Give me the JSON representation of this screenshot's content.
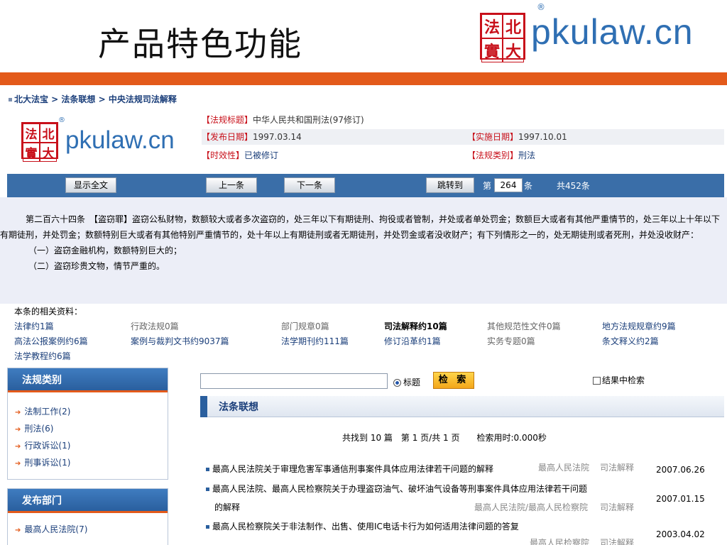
{
  "slide": {
    "title": "产品特色功能"
  },
  "brand": {
    "seal_chars": [
      "法",
      "北",
      "實",
      "大"
    ],
    "name": "pkulaw.cn",
    "registered": "®"
  },
  "breadcrumb": "北大法宝 > 法条联想 > 中央法规司法解释",
  "meta": {
    "title_key": "【法规标题】",
    "title_val": "中华人民共和国刑法(97修订)",
    "pub_key": "【发布日期】",
    "pub_val": "1997.03.14",
    "impl_key": "【实施日期】",
    "impl_val": "1997.10.01",
    "valid_key": "【时效性】",
    "valid_val": "已被修订",
    "cat_key": "【法规类别】",
    "cat_val": "刑法"
  },
  "toolbar": {
    "show_full": "显示全文",
    "prev": "上一条",
    "next": "下一条",
    "jump": "跳转到",
    "page_prefix": "第",
    "page_value": "264",
    "page_suffix": "条",
    "total": "共452条"
  },
  "article": {
    "para": "第二百六十四条　【盗窃罪】盗窃公私财物，数额较大或者多次盗窃的，处三年以下有期徒刑、拘役或者管制，并处或者单处罚金；数额巨大或者有其他严重情节的，处三年以上十年以下有期徒刑，并处罚金；数额特别巨大或者有其他特别严重情节的，处十年以上有期徒刑或者无期徒刑，并处罚金或者没收财产；有下列情形之一的，处无期徒刑或者死刑，并处没收财产：",
    "item1": "（一）盗窃金融机构，数额特别巨大的；",
    "item2": "（二）盗窃珍贵文物，情节严重的。"
  },
  "related": {
    "title": "本条的相关资料：",
    "row1": [
      "法律约1篇",
      "行政法规0篇",
      "部门规章0篇",
      "司法解释约10篇",
      "其他规范性文件0篇",
      "地方法规规章约9篇"
    ],
    "row2": [
      "高法公报案例约6篇",
      "案例与裁判文书约9037篇",
      "法学期刊约111篇",
      "修订沿革约1篇",
      "实务专题0篇",
      "条文释义约2篇"
    ],
    "row3": [
      "法学教程约6篇"
    ]
  },
  "sidebar": {
    "category_title": "法规类别",
    "categories": [
      "法制工作(2)",
      "刑法(6)",
      "行政诉讼(1)",
      "刑事诉讼(1)"
    ],
    "dept_title": "发布部门",
    "departments": [
      "最高人民法院(7)"
    ]
  },
  "search": {
    "radio_label": "标题",
    "button": "检 索",
    "within_label": "结果中检索"
  },
  "results": {
    "header": "法条联想",
    "summary": "共找到 10 篇　第 1 页/共 1 页　　检索用时:0.000秒",
    "items": [
      {
        "title": "最高人民法院关于审理危害军事通信刑事案件具体应用法律若干问题的解释",
        "source": "最高人民法院",
        "type": "司法解释",
        "date": "2007.06.26"
      },
      {
        "title": "最高人民法院、最高人民检察院关于办理盗窃油气、破坏油气设备等刑事案件具体应用法律若干问题",
        "title2": "的解释",
        "source": "最高人民法院/最高人民检察院",
        "type": "司法解释",
        "date": "2007.01.15"
      },
      {
        "title": "最高人民检察院关于非法制作、出售、使用IC电话卡行为如何适用法律问题的答复",
        "source": "最高人民检察院",
        "type": "司法解释",
        "date": "2003.04.02"
      }
    ]
  },
  "colors": {
    "accent": "#e35a1a",
    "brand_blue": "#2f6fb3",
    "toolbar": "#3a6ea8",
    "seal_red": "#c8101a"
  }
}
